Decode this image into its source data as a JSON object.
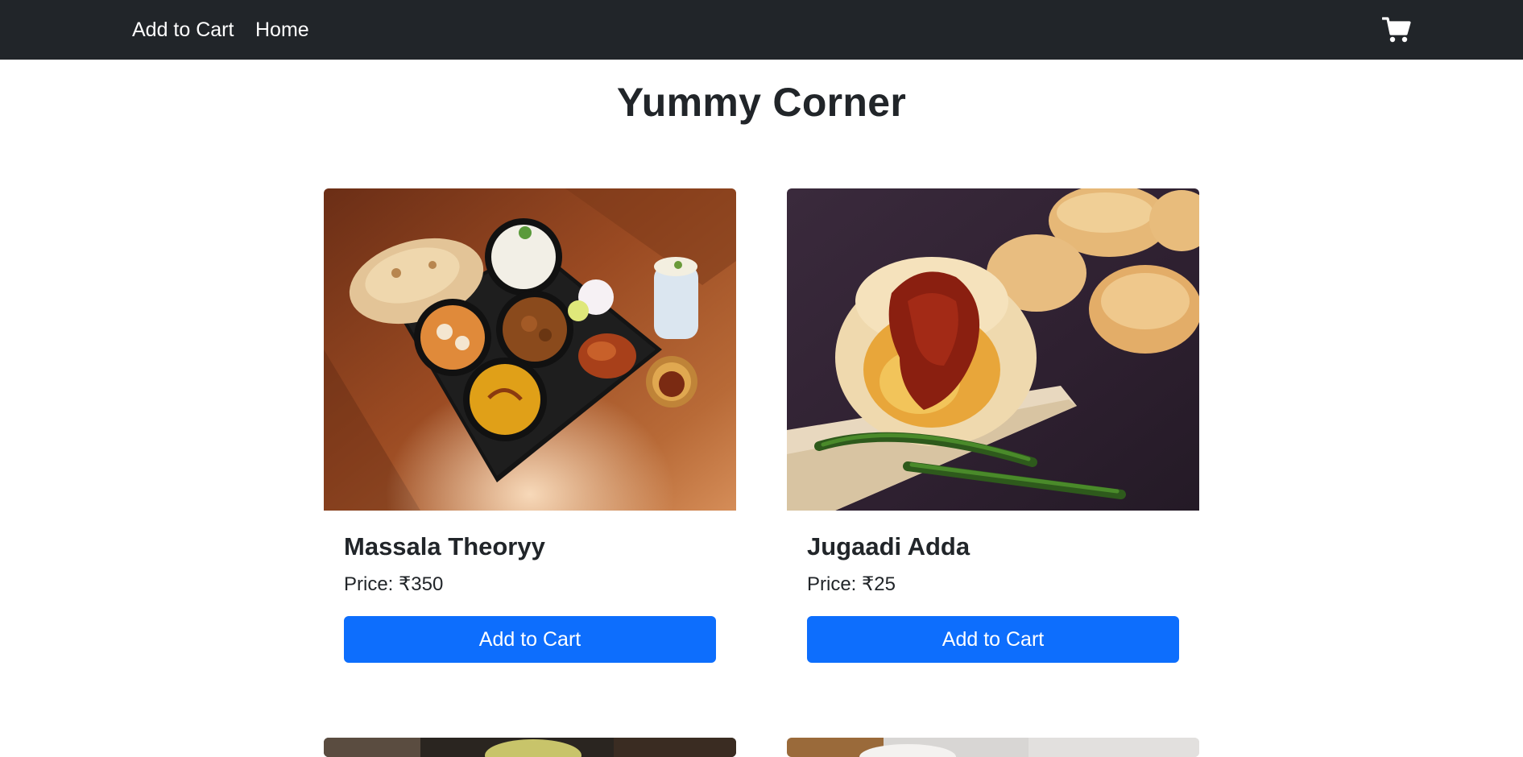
{
  "nav": {
    "brand": "Add to Cart",
    "home": "Home",
    "cart_icon": "shopping-cart-icon"
  },
  "page": {
    "title": "Yummy Corner"
  },
  "products": [
    {
      "name": "Massala Theoryy",
      "price": "Price: ₹350",
      "button": "Add to Cart"
    },
    {
      "name": "Jugaadi Adda",
      "price": "Price: ₹25",
      "button": "Add to Cart"
    }
  ],
  "colors": {
    "navbar": "#212529",
    "button": "#0d6efd",
    "text": "#212529"
  }
}
